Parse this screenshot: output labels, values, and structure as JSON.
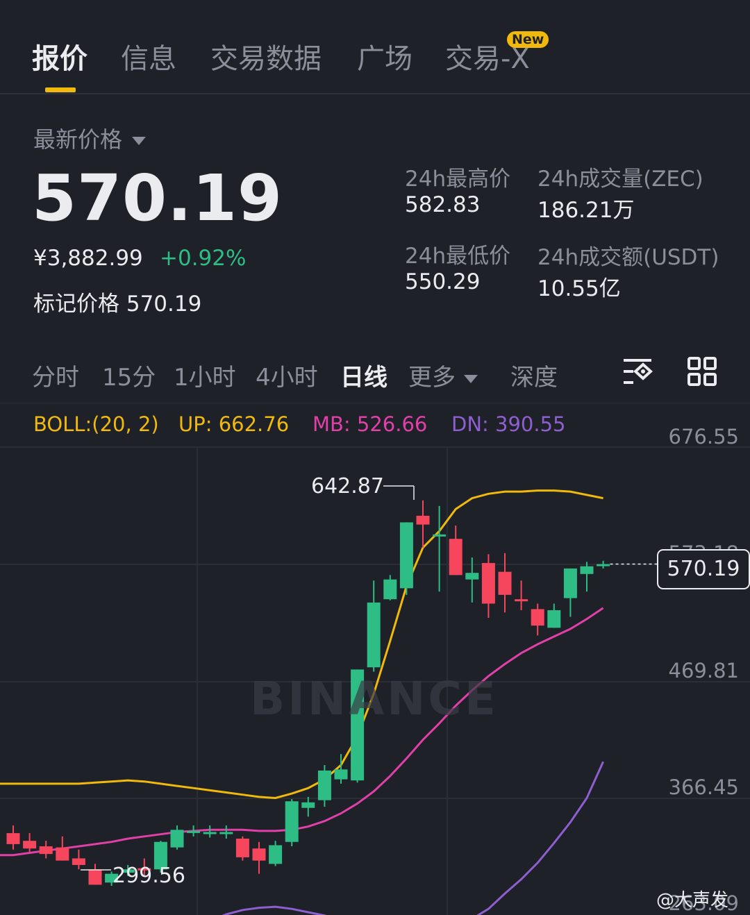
{
  "tabs": [
    {
      "label": "报价"
    },
    {
      "label": "信息"
    },
    {
      "label": "交易数据"
    },
    {
      "label": "广场"
    },
    {
      "label": "交易-X"
    }
  ],
  "new_badge": "New",
  "quote": {
    "latest_label": "最新价格",
    "price": "570.19",
    "cny_price": "¥3,882.99",
    "change_pct": "+0.92%",
    "mark_label": "标记价格",
    "mark_price": "570.19",
    "high_label": "24h最高价",
    "high": "582.83",
    "low_label": "24h最低价",
    "low": "550.29",
    "vol_label": "24h成交量(ZEC)",
    "vol": "186.21万",
    "turnover_label": "24h成交额(USDT)",
    "turnover": "10.55亿"
  },
  "intervals": [
    {
      "label": "分时"
    },
    {
      "label": "15分"
    },
    {
      "label": "1小时"
    },
    {
      "label": "4小时"
    },
    {
      "label": "日线"
    },
    {
      "label": "更多"
    },
    {
      "label": "深度"
    }
  ],
  "icons": {
    "indicator": "indicator-settings-icon",
    "layout": "grid-layout-icon"
  },
  "boll": {
    "params": "BOLL:(20, 2)",
    "up": "UP: 662.76",
    "mb": "MB: 526.66",
    "dn": "DN: 390.55"
  },
  "axis_labels": [
    "676.55",
    "573.18",
    "469.81",
    "366.45",
    "263.09"
  ],
  "current_price_tag": "570.19",
  "high_marker": "642.87",
  "low_marker": "299.56",
  "watermark": "BINANCE",
  "credit": "@大声发",
  "colors": {
    "up": "#2ebd85",
    "down": "#f6465d",
    "accent": "#f0b90b",
    "boll_up": "#f0b90b",
    "boll_mb": "#e040a8",
    "boll_dn": "#8e5fd0"
  },
  "chart_data": {
    "type": "candlestick",
    "ylim": [
      263.09,
      676.55
    ],
    "candles": [
      {
        "o": 325,
        "h": 332,
        "l": 310,
        "c": 315
      },
      {
        "o": 318,
        "h": 325,
        "l": 308,
        "c": 311
      },
      {
        "o": 313,
        "h": 318,
        "l": 302,
        "c": 306
      },
      {
        "o": 312,
        "h": 322,
        "l": 300,
        "c": 300
      },
      {
        "o": 302,
        "h": 310,
        "l": 292,
        "c": 296
      },
      {
        "o": 292,
        "h": 297,
        "l": 278,
        "c": 278
      },
      {
        "o": 280,
        "h": 290,
        "l": 277,
        "c": 288
      },
      {
        "o": 289,
        "h": 296,
        "l": 286,
        "c": 292
      },
      {
        "o": 293,
        "h": 302,
        "l": 286,
        "c": 292
      },
      {
        "o": 292,
        "h": 318,
        "l": 289,
        "c": 317
      },
      {
        "o": 312,
        "h": 332,
        "l": 310,
        "c": 328
      },
      {
        "o": 327,
        "h": 332,
        "l": 322,
        "c": 327
      },
      {
        "o": 326,
        "h": 332,
        "l": 321,
        "c": 326
      },
      {
        "o": 326,
        "h": 332,
        "l": 320,
        "c": 326
      },
      {
        "o": 320,
        "h": 322,
        "l": 300,
        "c": 303
      },
      {
        "o": 311,
        "h": 317,
        "l": 288,
        "c": 300
      },
      {
        "o": 297,
        "h": 318,
        "l": 295,
        "c": 314
      },
      {
        "o": 317,
        "h": 356,
        "l": 313,
        "c": 354
      },
      {
        "o": 348,
        "h": 358,
        "l": 340,
        "c": 353
      },
      {
        "o": 355,
        "h": 387,
        "l": 349,
        "c": 382
      },
      {
        "o": 374,
        "h": 397,
        "l": 370,
        "c": 383
      },
      {
        "o": 373,
        "h": 473,
        "l": 371,
        "c": 474
      },
      {
        "o": 476,
        "h": 555,
        "l": 472,
        "c": 535
      },
      {
        "o": 538,
        "h": 560,
        "l": 537,
        "c": 556
      },
      {
        "o": 548,
        "h": 598,
        "l": 542,
        "c": 608
      },
      {
        "o": 614,
        "h": 628,
        "l": 585,
        "c": 606
      },
      {
        "o": 597,
        "h": 623,
        "l": 545,
        "c": 597
      },
      {
        "o": 593,
        "h": 605,
        "l": 561,
        "c": 560
      },
      {
        "o": 556,
        "h": 576,
        "l": 535,
        "c": 562
      },
      {
        "o": 571,
        "h": 579,
        "l": 521,
        "c": 534
      },
      {
        "o": 563,
        "h": 580,
        "l": 526,
        "c": 542
      },
      {
        "o": 538,
        "h": 555,
        "l": 528,
        "c": 537
      },
      {
        "o": 529,
        "h": 534,
        "l": 505,
        "c": 514
      },
      {
        "o": 512,
        "h": 534,
        "l": 516,
        "c": 528
      },
      {
        "o": 539,
        "h": 561,
        "l": 522,
        "c": 566
      },
      {
        "o": 561,
        "h": 572,
        "l": 545,
        "c": 568
      },
      {
        "o": 570,
        "h": 573,
        "l": 566,
        "c": 570
      }
    ],
    "boll_up": [
      370,
      370,
      370,
      370,
      370,
      371,
      372,
      373,
      372,
      370,
      368,
      366,
      364,
      362,
      360,
      358,
      357,
      361,
      366,
      374,
      387,
      413,
      452,
      500,
      550,
      585,
      600,
      620,
      630,
      634,
      636,
      636,
      637,
      637,
      636,
      633,
      630
    ],
    "boll_mb": [
      305,
      307,
      309,
      311,
      313,
      315,
      317,
      320,
      322,
      324,
      326,
      327,
      328,
      328,
      328,
      327,
      327,
      328,
      331,
      336,
      343,
      352,
      363,
      377,
      393,
      410,
      425,
      441,
      455,
      468,
      479,
      489,
      497,
      504,
      511,
      520,
      530
    ],
    "boll_dn": [
      246,
      244,
      242,
      240,
      238,
      236,
      234,
      232,
      231,
      233,
      236,
      240,
      245,
      251,
      255,
      257,
      258,
      256,
      253,
      250,
      246,
      242,
      238,
      235,
      233,
      234,
      236,
      240,
      247,
      256,
      270,
      283,
      298,
      316,
      335,
      357,
      390
    ]
  }
}
